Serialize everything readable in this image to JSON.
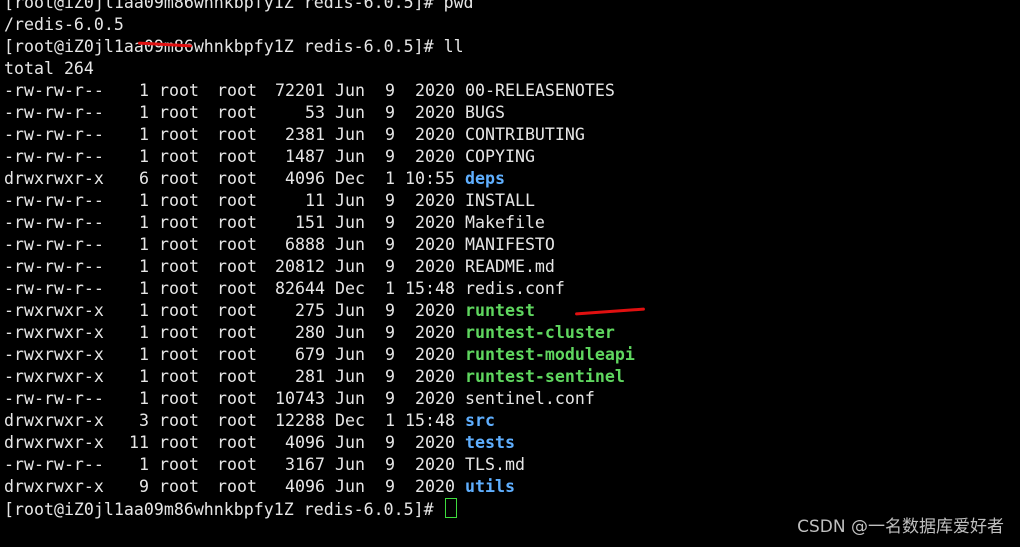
{
  "terminal": {
    "lines": [
      "[root@iZ0jl1aa09m86whnkbpfy1Z redis-6.0.5]# pwd",
      "/redis-6.0.5",
      "[root@iZ0jl1aa09m86whnkbpfy1Z redis-6.0.5]# ll",
      "total 264"
    ],
    "prompt": "[root@iZ0jl1aa09m86whnkbpfy1Z redis-6.0.5]# ",
    "colors": {
      "background": "#000000",
      "text": "#e6e6e6",
      "dir": "#5fafff",
      "exec": "#5fd75f",
      "cursor": "#3ddc3d",
      "annotation": "#e01010"
    },
    "files": [
      {
        "perm": "-rw-rw-r--",
        "links": "1",
        "owner": "root",
        "group": "root",
        "size": "72201",
        "mon": "Jun",
        "day": "9",
        "time": "2020",
        "name": "00-RELEASENOTES",
        "kind": "file"
      },
      {
        "perm": "-rw-rw-r--",
        "links": "1",
        "owner": "root",
        "group": "root",
        "size": "53",
        "mon": "Jun",
        "day": "9",
        "time": "2020",
        "name": "BUGS",
        "kind": "file"
      },
      {
        "perm": "-rw-rw-r--",
        "links": "1",
        "owner": "root",
        "group": "root",
        "size": "2381",
        "mon": "Jun",
        "day": "9",
        "time": "2020",
        "name": "CONTRIBUTING",
        "kind": "file"
      },
      {
        "perm": "-rw-rw-r--",
        "links": "1",
        "owner": "root",
        "group": "root",
        "size": "1487",
        "mon": "Jun",
        "day": "9",
        "time": "2020",
        "name": "COPYING",
        "kind": "file"
      },
      {
        "perm": "drwxrwxr-x",
        "links": "6",
        "owner": "root",
        "group": "root",
        "size": "4096",
        "mon": "Dec",
        "day": "1",
        "time": "10:55",
        "name": "deps",
        "kind": "dir"
      },
      {
        "perm": "-rw-rw-r--",
        "links": "1",
        "owner": "root",
        "group": "root",
        "size": "11",
        "mon": "Jun",
        "day": "9",
        "time": "2020",
        "name": "INSTALL",
        "kind": "file"
      },
      {
        "perm": "-rw-rw-r--",
        "links": "1",
        "owner": "root",
        "group": "root",
        "size": "151",
        "mon": "Jun",
        "day": "9",
        "time": "2020",
        "name": "Makefile",
        "kind": "file"
      },
      {
        "perm": "-rw-rw-r--",
        "links": "1",
        "owner": "root",
        "group": "root",
        "size": "6888",
        "mon": "Jun",
        "day": "9",
        "time": "2020",
        "name": "MANIFESTO",
        "kind": "file"
      },
      {
        "perm": "-rw-rw-r--",
        "links": "1",
        "owner": "root",
        "group": "root",
        "size": "20812",
        "mon": "Jun",
        "day": "9",
        "time": "2020",
        "name": "README.md",
        "kind": "file"
      },
      {
        "perm": "-rw-rw-r--",
        "links": "1",
        "owner": "root",
        "group": "root",
        "size": "82644",
        "mon": "Dec",
        "day": "1",
        "time": "15:48",
        "name": "redis.conf",
        "kind": "file"
      },
      {
        "perm": "-rwxrwxr-x",
        "links": "1",
        "owner": "root",
        "group": "root",
        "size": "275",
        "mon": "Jun",
        "day": "9",
        "time": "2020",
        "name": "runtest",
        "kind": "exec"
      },
      {
        "perm": "-rwxrwxr-x",
        "links": "1",
        "owner": "root",
        "group": "root",
        "size": "280",
        "mon": "Jun",
        "day": "9",
        "time": "2020",
        "name": "runtest-cluster",
        "kind": "exec"
      },
      {
        "perm": "-rwxrwxr-x",
        "links": "1",
        "owner": "root",
        "group": "root",
        "size": "679",
        "mon": "Jun",
        "day": "9",
        "time": "2020",
        "name": "runtest-moduleapi",
        "kind": "exec"
      },
      {
        "perm": "-rwxrwxr-x",
        "links": "1",
        "owner": "root",
        "group": "root",
        "size": "281",
        "mon": "Jun",
        "day": "9",
        "time": "2020",
        "name": "runtest-sentinel",
        "kind": "exec"
      },
      {
        "perm": "-rw-rw-r--",
        "links": "1",
        "owner": "root",
        "group": "root",
        "size": "10743",
        "mon": "Jun",
        "day": "9",
        "time": "2020",
        "name": "sentinel.conf",
        "kind": "file"
      },
      {
        "perm": "drwxrwxr-x",
        "links": "3",
        "owner": "root",
        "group": "root",
        "size": "12288",
        "mon": "Dec",
        "day": "1",
        "time": "15:48",
        "name": "src",
        "kind": "dir"
      },
      {
        "perm": "drwxrwxr-x",
        "links": "11",
        "owner": "root",
        "group": "root",
        "size": "4096",
        "mon": "Jun",
        "day": "9",
        "time": "2020",
        "name": "tests",
        "kind": "dir"
      },
      {
        "perm": "-rw-rw-r--",
        "links": "1",
        "owner": "root",
        "group": "root",
        "size": "3167",
        "mon": "Jun",
        "day": "9",
        "time": "2020",
        "name": "TLS.md",
        "kind": "file"
      },
      {
        "perm": "drwxrwxr-x",
        "links": "9",
        "owner": "root",
        "group": "root",
        "size": "4096",
        "mon": "Jun",
        "day": "9",
        "time": "2020",
        "name": "utils",
        "kind": "dir"
      }
    ]
  },
  "watermark": "CSDN @一名数据库爱好者"
}
